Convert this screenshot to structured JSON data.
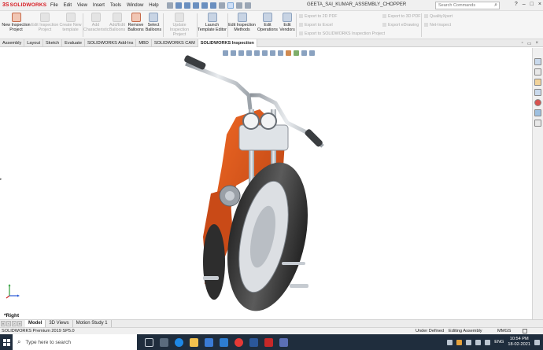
{
  "titlebar": {
    "logo_prefix": "3S",
    "logo_text": "SOLIDWORKS",
    "menu": [
      "File",
      "Edit",
      "View",
      "Insert",
      "Tools",
      "Window",
      "Help"
    ],
    "document_title": "GEETA_SAI_KUMAR_ASSEMBLY_CHOPPER",
    "search_placeholder": "Search Commands",
    "window_controls": [
      "?",
      "–",
      "□",
      "×"
    ]
  },
  "ribbon": {
    "buttons": [
      {
        "line1": "New Inspection",
        "line2": "Project",
        "enabled": true
      },
      {
        "line1": "Edit Inspection",
        "line2": "Project",
        "enabled": false
      },
      {
        "line1": "Create New",
        "line2": "template",
        "enabled": false
      },
      {
        "line1": "Add",
        "line2": "Characteristic",
        "enabled": false
      },
      {
        "line1": "Add/Edit",
        "line2": "Balloons",
        "enabled": false
      },
      {
        "line1": "Remove",
        "line2": "Balloons",
        "enabled": true
      },
      {
        "line1": "Select",
        "line2": "Balloons",
        "enabled": true
      },
      {
        "line1": "Update Inspection",
        "line2": "Project",
        "enabled": false
      },
      {
        "line1": "Launch",
        "line2": "Template Editor",
        "enabled": true
      },
      {
        "line1": "Edit Inspection",
        "line2": "Methods",
        "enabled": true
      },
      {
        "line1": "Edit",
        "line2": "Operations",
        "enabled": true
      },
      {
        "line1": "Edit",
        "line2": "Vendors",
        "enabled": true
      }
    ],
    "export_list_1": [
      "Export to 2D PDF",
      "Export to Excel",
      "Export to SOLIDWORKS Inspection Project"
    ],
    "export_list_2": [
      "Export to 3D PDF",
      "Export eDrawing"
    ],
    "export_list_3": [
      "QualityXpert",
      "Net-Inspect"
    ]
  },
  "tabs": [
    "Assembly",
    "Layout",
    "Sketch",
    "Evaluate",
    "SOLIDWORKS Add-Ins",
    "MBD",
    "SOLIDWORKS CAM",
    "SOLIDWORKS Inspection"
  ],
  "active_tab": "SOLIDWORKS Inspection",
  "view": {
    "name": "*Right"
  },
  "bottom_tabs": [
    "Model",
    "3D Views",
    "Motion Study 1"
  ],
  "status": {
    "product": "SOLIDWORKS Premium 2019 SP5.0",
    "definition": "Under Defined",
    "mode": "Editing Assembly",
    "units": "MMGS"
  },
  "taskbar": {
    "search_placeholder": "Type here to search",
    "language": "ENG",
    "time": "10:54 PM",
    "date": "18-02-2021"
  },
  "colors": {
    "accent_red": "#d71920",
    "frame_orange": "#d9541c",
    "taskbar": "#1f2d3d"
  }
}
